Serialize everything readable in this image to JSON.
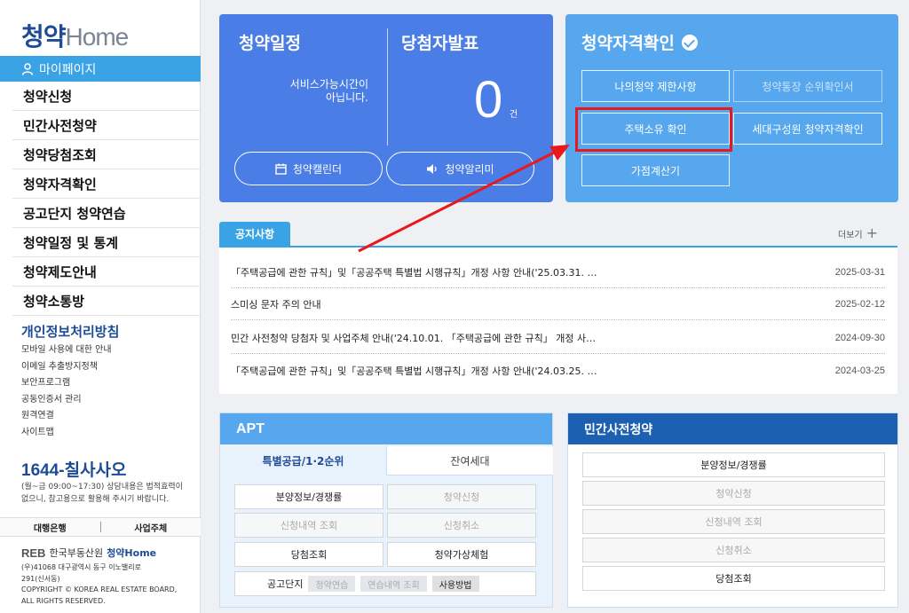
{
  "sidebar": {
    "logo_prefix": "청약",
    "logo_home": "Home",
    "mypage": "마이페이지",
    "menu": [
      "청약신청",
      "민간사전청약",
      "청약당첨조회",
      "청약자격확인",
      "공고단지 청약연습",
      "청약일정 및 통계",
      "청약제도안내",
      "청약소통방"
    ],
    "privacy_title": "개인정보처리방침",
    "links": [
      "모바일 사용에 대한 안내",
      "이메일 추출방지정책",
      "보안프로그램",
      "공동인증서 관리",
      "원격연결",
      "사이트맵"
    ],
    "phone": "1644-칠사사오",
    "phone_desc": "(월~금 09:00~17:30) 상담내용은 법적효력이 없으니, 참고용으로 활용해 주시기 바랍니다.",
    "bank_bar": [
      "대행은행",
      "사업주체"
    ],
    "reb_brand": "REB",
    "reb_name": "한국부동산원",
    "reb_home": "청약Home",
    "address": [
      "(우)41068 대구광역시 동구 이노밸리로",
      "291(신서동)",
      "COPYRIGHT © KOREA REAL ESTATE BOARD,",
      "ALL RIGHTS RESERVED."
    ]
  },
  "schedule": {
    "title": "청약일정",
    "winner_title": "당첨자발표",
    "service_text_line1": "서비스가능시간이",
    "service_text_line2": "아닙니다.",
    "count": "0",
    "count_unit": "건",
    "calendar_button": "청약캘린더",
    "alarm_button": "청약알리미"
  },
  "qualification": {
    "title": "청약자격확인",
    "buttons": [
      {
        "label": "나의청약 제한사항",
        "dim": false
      },
      {
        "label": "청약통장 순위확인서",
        "dim": true
      },
      {
        "label": "주택소유 확인",
        "dim": false
      },
      {
        "label": "세대구성원 청약자격확인",
        "dim": false
      },
      {
        "label": "가점계산기",
        "dim": false
      }
    ]
  },
  "notices": {
    "tab": "공지사항",
    "more": "더보기",
    "items": [
      {
        "text": "「주택공급에 관한 규칙」및「공공주택 특별법 시행규칙」개정 사항 안내('25.03.31. …",
        "date": "2025-03-31"
      },
      {
        "text": "스미싱 문자 주의 안내",
        "date": "2025-02-12"
      },
      {
        "text": "민간 사전청약 당첨자 및 사업주체 안내('24.10.01. 「주택공급에 관한 규칙」 개정 사…",
        "date": "2024-09-30"
      },
      {
        "text": "「주택공급에 관한 규칙」및「공공주택 특별법 시행규칙」개정 사항 안내('24.03.25. …",
        "date": "2024-03-25"
      }
    ]
  },
  "apt": {
    "title": "APT",
    "tab_active": "특별공급/1·2순위",
    "tab_inactive": "잔여세대",
    "buttons": [
      {
        "label": "분양정보/경쟁률",
        "dim": false
      },
      {
        "label": "청약신청",
        "dim": true
      },
      {
        "label": "신청내역 조회",
        "dim": true
      },
      {
        "label": "신청취소",
        "dim": true
      },
      {
        "label": "당첨조회",
        "dim": false
      },
      {
        "label": "청약가상체험",
        "dim": false
      }
    ],
    "gongo_label": "공고단지",
    "chips": [
      {
        "label": "청약연습",
        "on": false
      },
      {
        "label": "연습내역 조회",
        "on": false
      },
      {
        "label": "사용방법",
        "on": true
      }
    ]
  },
  "private": {
    "title": "민간사전청약",
    "buttons": [
      {
        "label": "분양정보/경쟁률",
        "dim": false
      },
      {
        "label": "청약신청",
        "dim": true
      },
      {
        "label": "신청내역 조회",
        "dim": true
      },
      {
        "label": "신청취소",
        "dim": true
      },
      {
        "label": "당첨조회",
        "dim": false
      }
    ]
  },
  "colors": {
    "primary": "#4a7de6",
    "accent": "#39a3e6",
    "brand": "#1d4b96",
    "highlight": "#e8181b"
  }
}
